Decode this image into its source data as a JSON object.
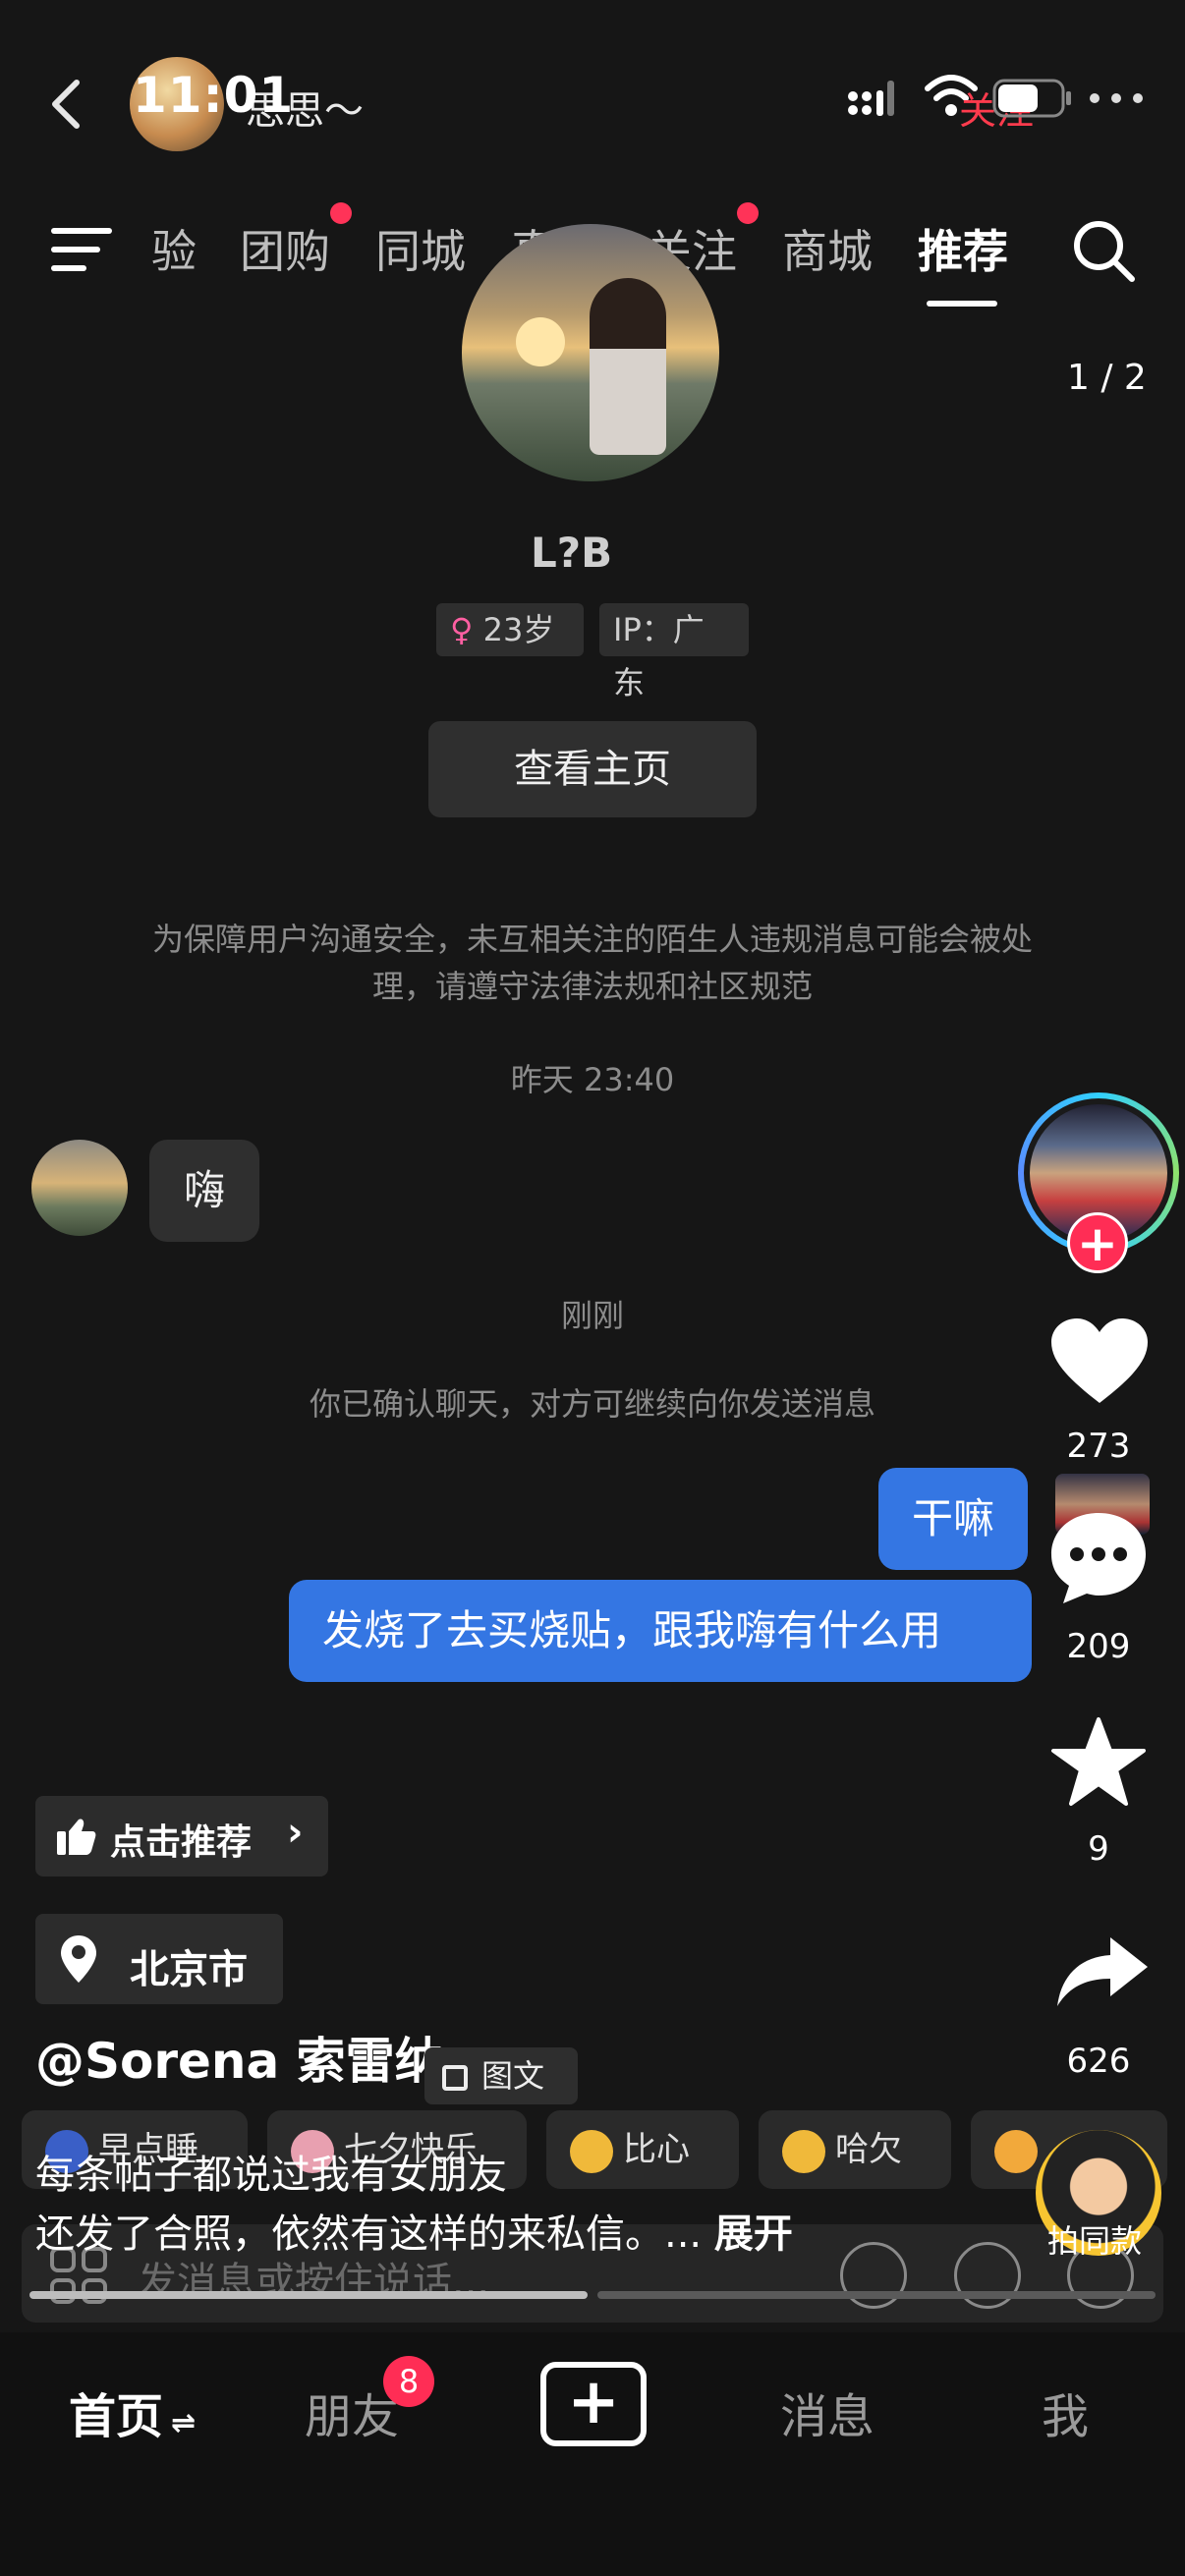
{
  "status_bar": {
    "time": "11:01"
  },
  "chat_header": {
    "title": "思思～",
    "follow_label": "关注"
  },
  "tabs": [
    {
      "label": "验"
    },
    {
      "label": "团购"
    },
    {
      "label": "同城"
    },
    {
      "label": "直播"
    },
    {
      "label": "关注"
    },
    {
      "label": "商城"
    },
    {
      "label": "推荐"
    }
  ],
  "page_indicator": "1 / 2",
  "profile": {
    "name": "L?B",
    "age_tag": "23岁",
    "ip_tag": "IP：广东",
    "view_home_button": "查看主页"
  },
  "chat": {
    "safety_notice": "为保障用户沟通安全，未互相关注的陌生人违规消息可能会被处理，请遵守法律法规和社区规范",
    "timestamp_1": "昨天 23:40",
    "incoming_1": "嗨",
    "timestamp_2": "刚刚",
    "system_notice": "你已确认聊天，对方可继续向你发送消息",
    "outgoing_1": "干嘛",
    "outgoing_2": "发烧了去买烧贴，跟我嗨有什么用"
  },
  "right_rail": {
    "likes": "273",
    "comments": "209",
    "favorites": "9",
    "shares": "626"
  },
  "video_overlay": {
    "recommend_label": "点击推荐",
    "location_label": "北京市",
    "author": "@Sorena 索雷纳",
    "content_type_tag": "图文",
    "caption_line1": "每条帖子都说过我有女朋友",
    "caption_line2": "还发了合照，依然有这样的来私信。...",
    "expand_label": "展开",
    "same_style_label": "拍同款"
  },
  "quick_emojis": [
    {
      "label": "早点睡"
    },
    {
      "label": "七夕快乐"
    },
    {
      "label": "比心"
    },
    {
      "label": "哈欠"
    }
  ],
  "message_input": {
    "placeholder": "发消息或按住说话..."
  },
  "bottom_nav": {
    "home": "首页",
    "friends": "朋友",
    "friends_badge": "8",
    "create": "+",
    "messages": "消息",
    "me": "我"
  },
  "colors": {
    "accent_blue": "#3476e3",
    "badge_red": "#ff2d55",
    "background": "#161616"
  }
}
